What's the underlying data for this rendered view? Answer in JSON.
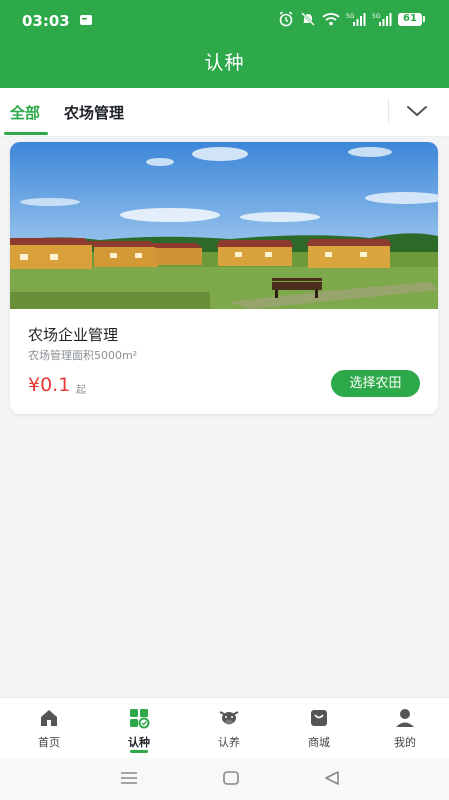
{
  "status_bar": {
    "time": "03:03",
    "battery": "61",
    "network_labels": [
      "5G",
      "5G"
    ]
  },
  "header": {
    "title": "认种"
  },
  "tabs": [
    {
      "label": "全部",
      "active": true
    },
    {
      "label": "农场管理",
      "active": false
    }
  ],
  "card": {
    "title": "农场企业管理",
    "subtitle": "农场管理面积5000m²",
    "price": "¥0.1",
    "price_unit": "起",
    "action_label": "选择农田"
  },
  "bottom_nav": [
    {
      "label": "首页",
      "icon": "home-icon",
      "active": false
    },
    {
      "label": "认种",
      "icon": "plant-grid-icon",
      "active": true
    },
    {
      "label": "认养",
      "icon": "cow-icon",
      "active": false
    },
    {
      "label": "商城",
      "icon": "shop-icon",
      "active": false
    },
    {
      "label": "我的",
      "icon": "user-icon",
      "active": false
    }
  ],
  "colors": {
    "brand_green": "#2ea94a",
    "price_red": "#e53935"
  }
}
